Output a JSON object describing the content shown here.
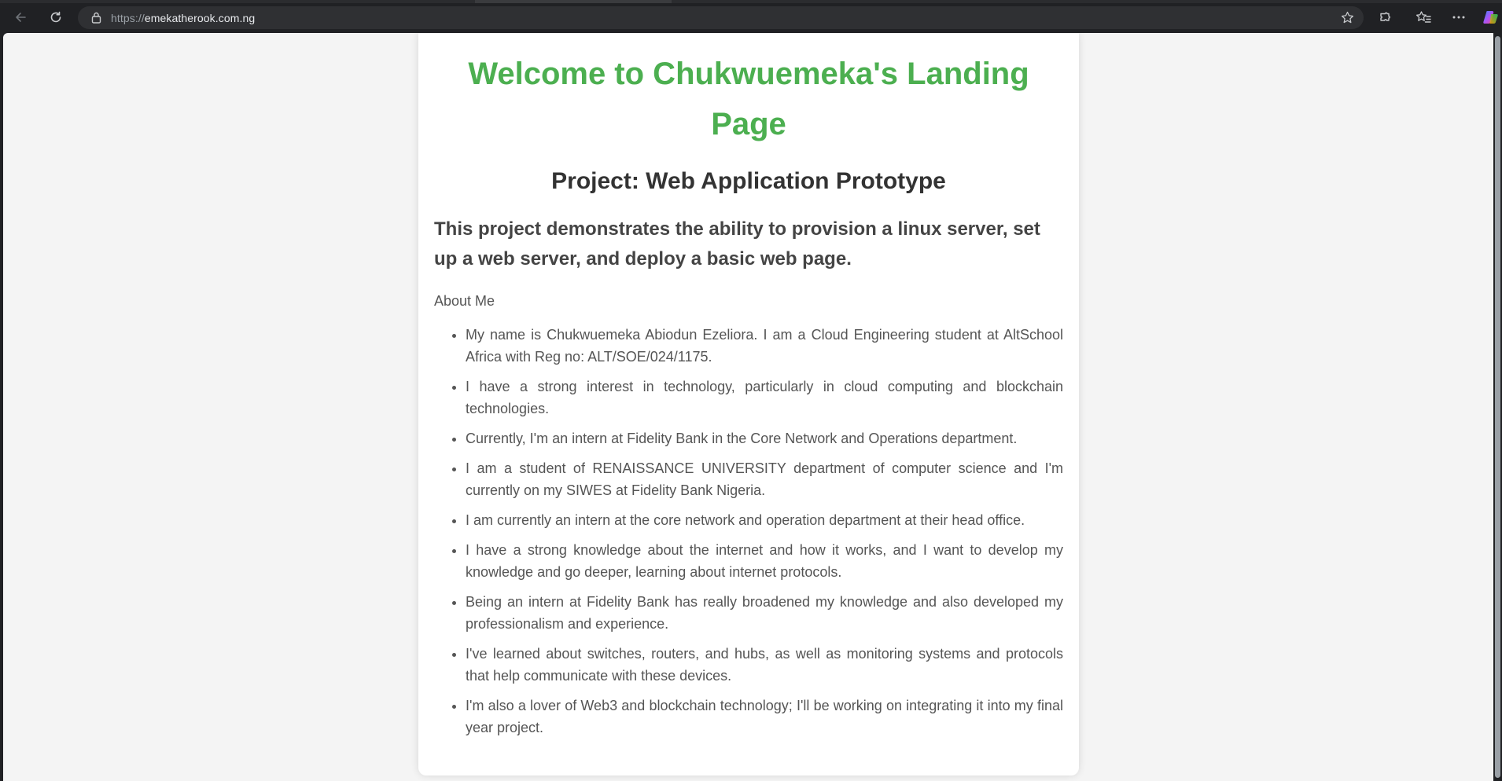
{
  "browser": {
    "url_scheme": "https://",
    "url_host": "emekatherook.com.ng",
    "icons": [
      "back-arrow-icon",
      "reload-icon",
      "lock-icon",
      "star-icon",
      "extensions-icon",
      "favorites-icon",
      "more-icon",
      "copilot-icon"
    ]
  },
  "page": {
    "title": "Welcome to Chukwuemeka's Landing Page",
    "project_heading": "Project: Web Application Prototype",
    "tagline": "This project demonstrates the ability to provision a linux server, set up a web server, and deploy a basic web page.",
    "about_label": "About Me",
    "about_items": [
      "My name is Chukwuemeka Abiodun Ezeliora. I am a Cloud Engineering student at AltSchool Africa with Reg no: ALT/SOE/024/1175.",
      "I have a strong interest in technology, particularly in cloud computing and blockchain technologies.",
      "Currently, I'm an intern at Fidelity Bank in the Core Network and Operations department.",
      "I am a student of RENAISSANCE UNIVERSITY department of computer science and I'm currently on my SIWES at Fidelity Bank Nigeria.",
      "I am currently an intern at the core network and operation department at their head office.",
      "I have a strong knowledge about the internet and how it works, and I want to develop my knowledge and go deeper, learning about internet protocols.",
      "Being an intern at Fidelity Bank has really broadened my knowledge and also developed my professionalism and experience.",
      "I've learned about switches, routers, and hubs, as well as monitoring systems and protocols that help communicate with these devices.",
      "I'm also a lover of Web3 and blockchain technology; I'll be working on integrating it into my final year project."
    ]
  },
  "colors": {
    "title_green": "#4caf50",
    "chrome_bg": "#202124",
    "page_bg": "#f4f4f4"
  }
}
